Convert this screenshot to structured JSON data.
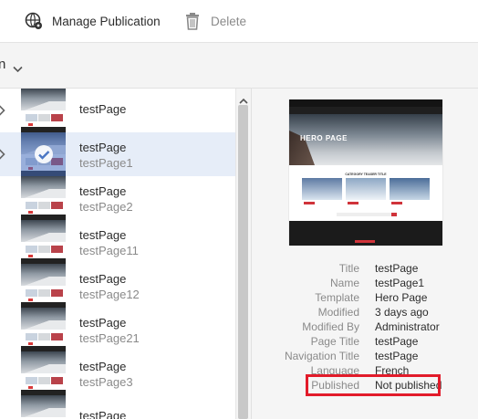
{
  "toolbar": {
    "manage_label": "Manage Publication",
    "delete_label": "Delete"
  },
  "subbar": {
    "label": "n"
  },
  "list": {
    "items": [
      {
        "title": "testPage",
        "subtitle": "",
        "selected": false
      },
      {
        "title": "testPage",
        "subtitle": "testPage1",
        "selected": true
      },
      {
        "title": "testPage",
        "subtitle": "testPage2",
        "selected": false
      },
      {
        "title": "testPage",
        "subtitle": "testPage11",
        "selected": false
      },
      {
        "title": "testPage",
        "subtitle": "testPage12",
        "selected": false
      },
      {
        "title": "testPage",
        "subtitle": "testPage21",
        "selected": false
      },
      {
        "title": "testPage",
        "subtitle": "testPage3",
        "selected": false
      },
      {
        "title": "testPage",
        "subtitle": "",
        "selected": false
      }
    ]
  },
  "preview": {
    "hero_title": "HERO PAGE",
    "category_title": "CATEGORY TEASER TITLE"
  },
  "properties": [
    {
      "key": "Title",
      "value": "testPage"
    },
    {
      "key": "Name",
      "value": "testPage1"
    },
    {
      "key": "Template",
      "value": "Hero Page"
    },
    {
      "key": "Modified",
      "value": "3 days ago"
    },
    {
      "key": "Modified By",
      "value": "Administrator"
    },
    {
      "key": "Page Title",
      "value": "testPage"
    },
    {
      "key": "Navigation Title",
      "value": "testPage"
    },
    {
      "key": "Language",
      "value": "French"
    },
    {
      "key": "Published",
      "value": "Not published"
    }
  ],
  "colors": {
    "selected_row": "#e6edf8",
    "highlight": "#e21b2a"
  }
}
